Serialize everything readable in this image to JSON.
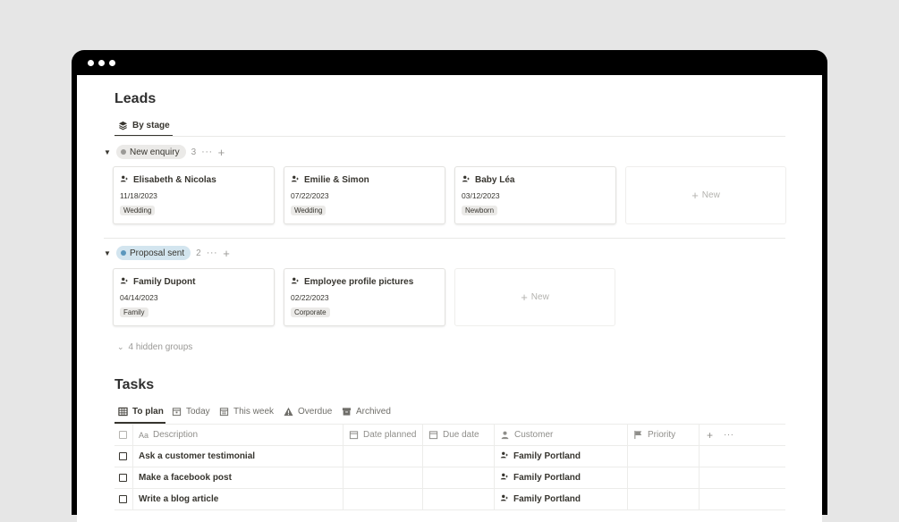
{
  "leads": {
    "title": "Leads",
    "view_tab": "By stage",
    "groups": [
      {
        "label": "New enquiry",
        "count": "3",
        "color": "#ebeae8",
        "dot_color": "#9b9a97",
        "cards": [
          {
            "name": "Elisabeth & Nicolas",
            "date": "11/18/2023",
            "tag": "Wedding"
          },
          {
            "name": "Emilie & Simon",
            "date": "07/22/2023",
            "tag": "Wedding"
          },
          {
            "name": "Baby Léa",
            "date": "03/12/2023",
            "tag": "Newborn"
          }
        ],
        "new_label": "New"
      },
      {
        "label": "Proposal sent",
        "count": "2",
        "color": "#d3e5ef",
        "dot_color": "#5b97bd",
        "cards": [
          {
            "name": "Family Dupont",
            "date": "04/14/2023",
            "tag": "Family"
          },
          {
            "name": "Employee profile pictures",
            "date": "02/22/2023",
            "tag": "Corporate"
          }
        ],
        "new_label": "New"
      }
    ],
    "hidden_groups": "4 hidden groups"
  },
  "tasks": {
    "title": "Tasks",
    "tabs": [
      {
        "label": "To plan",
        "icon": "table-icon"
      },
      {
        "label": "Today",
        "icon": "calendar-icon"
      },
      {
        "label": "This week",
        "icon": "calendar-icon"
      },
      {
        "label": "Overdue",
        "icon": "warning-icon"
      },
      {
        "label": "Archived",
        "icon": "archive-icon"
      }
    ],
    "columns": {
      "description": "Description",
      "description_prefix": "Aa",
      "date_planned": "Date planned",
      "due_date": "Due date",
      "customer": "Customer",
      "priority": "Priority"
    },
    "rows": [
      {
        "description": "Ask a customer testimonial",
        "customer": "Family Portland"
      },
      {
        "description": "Make a facebook post",
        "customer": "Family Portland"
      },
      {
        "description": "Write a blog article",
        "customer": "Family Portland"
      }
    ]
  }
}
